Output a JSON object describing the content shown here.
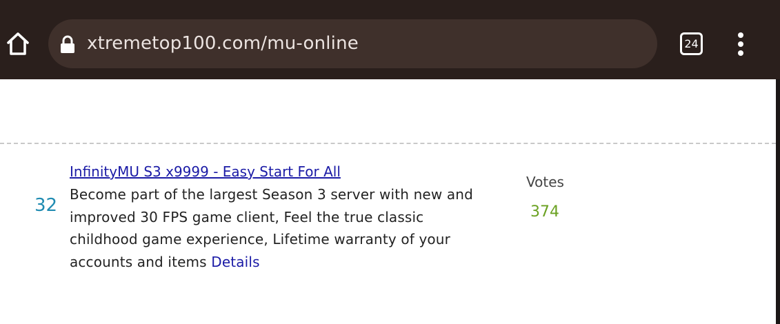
{
  "browser": {
    "url": "xtremetop100.com/mu-online",
    "tab_count": "24",
    "icons": {
      "home": "home-icon",
      "lock": "lock-icon",
      "tabs": "tabs-counter-icon",
      "menu": "more-vertical-icon"
    }
  },
  "listing": {
    "rank": "32",
    "title": "InfinityMU S3 x9999 - Easy Start For All",
    "description": "Become part of the largest Season 3 server with new and improved 30 FPS game client, Feel the true classic childhood game experience, Lifetime warranty of your accounts and items",
    "details_label": "Details",
    "votes_label": "Votes",
    "votes_count": "374"
  },
  "colors": {
    "toolbar_bg": "#2a1f1c",
    "url_pill_bg": "#3f302b",
    "rank": "#1f8bb1",
    "link": "#1a1aa6",
    "votes_count": "#6aa121"
  }
}
